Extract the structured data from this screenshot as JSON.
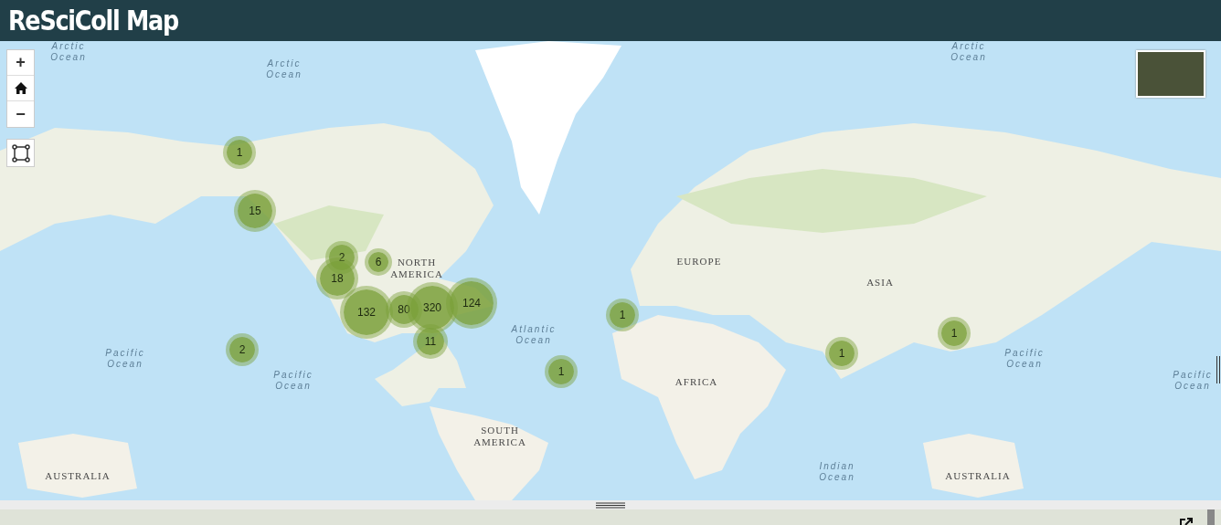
{
  "header": {
    "title": "ReSciColl Map"
  },
  "map_controls": {
    "zoom_in": "+",
    "zoom_out": "−"
  },
  "map_labels": [
    {
      "text": "Arctic Ocean",
      "kind": "ocean"
    },
    {
      "text": "Arctic Ocean",
      "kind": "ocean"
    },
    {
      "text": "Arctic Ocean",
      "kind": "ocean"
    },
    {
      "text": "EUROPE",
      "kind": "continent"
    },
    {
      "text": "NORTH AMERICA",
      "kind": "continent"
    },
    {
      "text": "ASIA",
      "kind": "continent"
    },
    {
      "text": "Atlantic Ocean",
      "kind": "ocean"
    },
    {
      "text": "Pacific Ocean",
      "kind": "ocean"
    },
    {
      "text": "Pacific Ocean",
      "kind": "ocean"
    },
    {
      "text": "Pacific Ocean",
      "kind": "ocean"
    },
    {
      "text": "AFRICA",
      "kind": "continent"
    },
    {
      "text": "Pacific Ocean",
      "kind": "ocean"
    },
    {
      "text": "SOUTH AMERICA",
      "kind": "continent"
    },
    {
      "text": "AUSTRALIA",
      "kind": "continent"
    },
    {
      "text": "Indian Ocean",
      "kind": "ocean"
    },
    {
      "text": "AUSTRALIA",
      "kind": "continent"
    }
  ],
  "clusters": [
    {
      "count": "1"
    },
    {
      "count": "15"
    },
    {
      "count": "2"
    },
    {
      "count": "6"
    },
    {
      "count": "18"
    },
    {
      "count": "132"
    },
    {
      "count": "80"
    },
    {
      "count": "320"
    },
    {
      "count": "124"
    },
    {
      "count": "11"
    },
    {
      "count": "1"
    },
    {
      "count": "1"
    },
    {
      "count": "1"
    },
    {
      "count": "1"
    },
    {
      "count": "2"
    }
  ]
}
